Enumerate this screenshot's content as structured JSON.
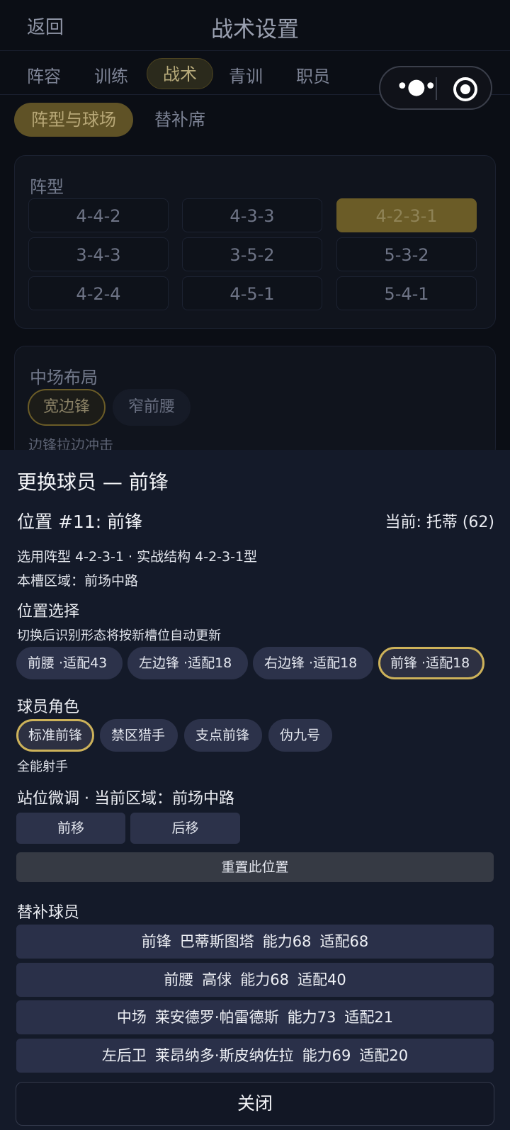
{
  "header": {
    "back_label": "返回",
    "title": "战术设置"
  },
  "tabs": [
    "阵容",
    "训练",
    "战术",
    "青训",
    "职员"
  ],
  "active_tab": "战术",
  "capsule": {
    "more_icon": "more-dots-icon",
    "close_icon": "target-icon"
  },
  "subtabs": [
    "阵型与球场",
    "替补席"
  ],
  "formation_card": {
    "title": "阵型",
    "options": [
      "4-4-2",
      "4-3-3",
      "4-2-3-1",
      "3-4-3",
      "3-5-2",
      "5-3-2",
      "4-2-4",
      "4-5-1",
      "5-4-1"
    ],
    "selected": "4-2-3-1"
  },
  "midfield_card": {
    "title": "中场布局",
    "options": [
      "宽边锋",
      "窄前腰"
    ],
    "selected": "宽边锋",
    "description": "边锋拉边冲击"
  },
  "sheet": {
    "title": "更换球员 — 前锋",
    "slot_label": "位置 #11: 前锋",
    "current_label": "当前: 托蒂 (62)",
    "formation_info": "选用阵型 4-2-3-1 · 实战结构 4-2-3-1型",
    "zone_info": "本槽区域：前场中路",
    "position_section": "位置选择",
    "position_hint": "切换后识别形态将按新槽位自动更新",
    "positions": [
      "前腰 ·适配43",
      "左边锋 ·适配18",
      "右边锋 ·适配18",
      "前锋 ·适配18"
    ],
    "role_section": "球员角色",
    "roles": [
      "标准前锋",
      "禁区猎手",
      "支点前锋",
      "伪九号"
    ],
    "role_desc": "全能射手",
    "adjust_section": "站位微调 · 当前区域：前场中路",
    "move_forward": "前移",
    "move_back": "后移",
    "reset_label": "重置此位置",
    "subs_section": "替补球员",
    "subs": [
      [
        "前锋",
        "巴蒂斯图塔",
        "能力68",
        "适配68"
      ],
      [
        "前腰",
        "高俅",
        "能力68",
        "适配40"
      ],
      [
        "中场",
        "莱安德罗·帕雷德斯",
        "能力73",
        "适配21"
      ],
      [
        "左后卫",
        "莱昂纳多·斯皮纳佐拉",
        "能力69",
        "适配20"
      ]
    ],
    "close_label": "关闭"
  },
  "colors": {
    "accent_gold": "#cdb25a",
    "sheet_bg": "#141a29",
    "chip_bg": "#2c324a"
  }
}
